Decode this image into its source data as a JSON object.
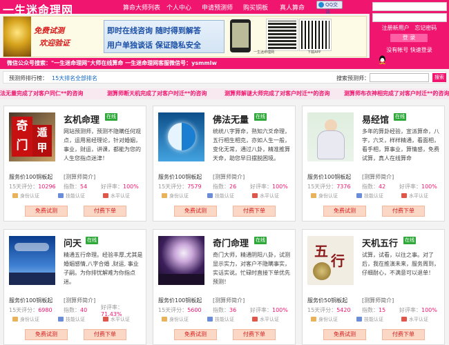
{
  "header": {
    "logo": "一生迷命理网",
    "nav": [
      "算命大师列表",
      "个人中心",
      "申请预测师",
      "购买铜板",
      "真人算命"
    ],
    "qq_label": "QQ交谈"
  },
  "login": {
    "register_link": "注册新用户",
    "forgot_link": "忘记密码",
    "login_button": "登 录",
    "no_account": "没有帐号 快速登录"
  },
  "banner": {
    "red_line1": "免费试测",
    "red_line2": "欢迎验证",
    "main_line1": "即时在线咨询  随时得到解答",
    "main_line2": "用户单独谈话  保证隐私安全",
    "qr_caption1": "一生迷命理网",
    "qr_caption2": "下载APP"
  },
  "wechat": "微信公众号搜索：\"一生迷命理网\"大师在线算命      一生迷命理网客服微信号：ysmmlw",
  "rankbar": {
    "label": "预测师排行榜：",
    "top15": "15大排名",
    "all": "全部排名",
    "search_label": "搜索预测师：",
    "search_button": "搜索"
  },
  "notices": [
    "卦法无量完成了对客户同仁**的咨询",
    "测算师断天机完成了对客户时迁**的咨询",
    "测算师解谜大师完成了对客户时迁**的咨询",
    "测算师布衣神相完成了对客户时迁**的咨询"
  ],
  "card_labels": {
    "online": "在线",
    "intro": "[测算师简介]",
    "cert_id": "身份认证",
    "cert_skill": "技能认证",
    "cert_level": "水平认证",
    "free_test": "免费试测",
    "paid_order": "付费下单"
  },
  "cards": [
    {
      "name": "玄机命理",
      "desc": "网站预测师，预测不隐瞒任何观点，运用易经理论，针对婚姻，事业，财运，讲课，都能为您的人生您指点迷津！",
      "price": "服务价100铜板起",
      "eval": "15天评分：",
      "eval_val": "10296",
      "index": "指数：",
      "index_val": "54",
      "rate": "好评率：",
      "rate_val": "100%",
      "thumb": "qimen"
    },
    {
      "name": "佛法无量",
      "desc": "统统八字算命，熟知六爻命理，五行相生相克，亦如人生一般，变化无常，通过八卦，精准推算天命，助您早日摆脱困境。",
      "price": "服务价100铜板起",
      "eval": "15天评分：",
      "eval_val": "7579",
      "index": "指数：",
      "index_val": "26",
      "rate": "好评率：",
      "rate_val": "100%",
      "thumb": "taiji"
    },
    {
      "name": "易经馆",
      "desc": "多年的算卦经验，宣派算命，八字，六爻，样样精通，看面相，看手相，算事业，算情感，免费试算，真人在线算命",
      "price": "服务价100铜板起",
      "eval": "15天评分：",
      "eval_val": "7376",
      "index": "指数：",
      "index_val": "42",
      "rate": "好评率：",
      "rate_val": "100%",
      "thumb": "monk"
    },
    {
      "name": "问天",
      "desc": "精通五行命理。经验丰厚,尤其是婚姻感情,八字合婚 ,财运, 事业 子嗣。为你排忧解难为你指点迷。",
      "price": "服务价100铜板起",
      "eval": "15天评分：",
      "eval_val": "6980",
      "index": "指数：",
      "index_val": "40",
      "rate": "好评率：",
      "rate_val": "71.43%",
      "thumb": "sky"
    },
    {
      "name": "奇门命理",
      "desc": "奇门大师，精通阴阳八卦，试测显示实力，对客户不隐瞒事实，实话实说。忙碌时直接下单优先预测！",
      "price": "服务价100铜板起",
      "eval": "15天评分：",
      "eval_val": "5600",
      "index": "指数：",
      "index_val": "36",
      "rate": "好评率：",
      "rate_val": "100%",
      "thumb": "moon"
    },
    {
      "name": "天机五行",
      "desc": "试算，试看，以往之事。对了后，我在推演未来，服务周到，仔细耐心，不满意可以退单！",
      "price": "服务价50铜板起",
      "eval": "15天评分：",
      "eval_val": "5420",
      "index": "指数：",
      "index_val": "15",
      "rate": "好评率：",
      "rate_val": "100%",
      "thumb": "wuxing"
    }
  ]
}
